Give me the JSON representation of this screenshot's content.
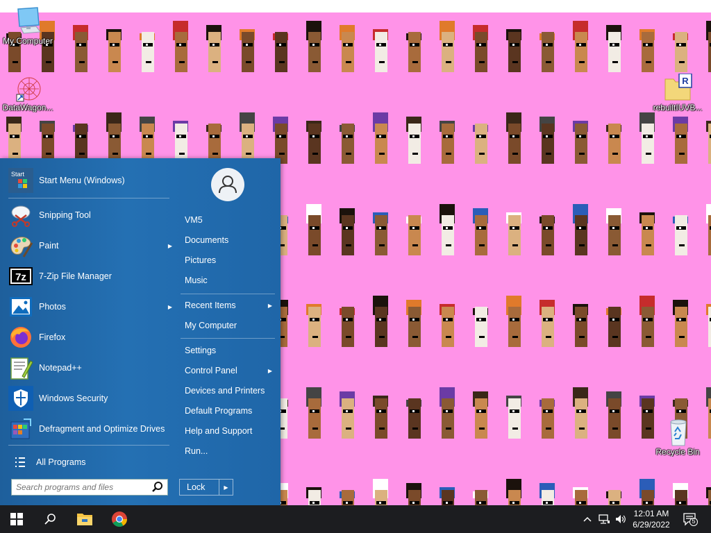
{
  "desktop": {
    "icons": [
      {
        "label": "My Computer"
      },
      {
        "label": "DataWagon..."
      },
      {
        "label": "rebuiltIUVB..."
      },
      {
        "label": "Recycle Bin"
      }
    ],
    "wallpaper_color": "#ff93e8"
  },
  "start_menu": {
    "pinned": [
      {
        "label": "Start Menu (Windows)",
        "icon": "start-menu-icon",
        "icon_text": "Start"
      },
      {
        "label": "Snipping Tool",
        "icon": "snipping-tool-icon"
      },
      {
        "label": "Paint",
        "icon": "paint-palette-icon",
        "has_submenu": true
      },
      {
        "label": "7-Zip File Manager",
        "icon": "seven-zip-icon",
        "icon_text": "7z"
      },
      {
        "label": "Photos",
        "icon": "photos-icon",
        "has_submenu": true
      },
      {
        "label": "Firefox",
        "icon": "firefox-icon"
      },
      {
        "label": "Notepad++",
        "icon": "notepadplusplus-icon"
      },
      {
        "label": "Windows Security",
        "icon": "shield-icon"
      },
      {
        "label": "Defragment and Optimize Drives",
        "icon": "defrag-icon"
      }
    ],
    "all_programs": "All Programs",
    "search_placeholder": "Search programs and files",
    "places": [
      {
        "label": "VM5"
      },
      {
        "label": "Documents"
      },
      {
        "label": "Pictures"
      },
      {
        "label": "Music"
      },
      {
        "label": "Recent Items",
        "has_submenu": true
      },
      {
        "label": "My Computer"
      },
      {
        "label": "Settings"
      },
      {
        "label": "Control Panel",
        "has_submenu": true
      },
      {
        "label": "Devices and Printers"
      },
      {
        "label": "Default Programs"
      },
      {
        "label": "Help and Support"
      },
      {
        "label": "Run..."
      }
    ],
    "power_button": "Lock",
    "accent_color": "#2470b3"
  },
  "taskbar": {
    "buttons": [
      "windows-start-icon",
      "search-icon",
      "file-explorer-icon",
      "chrome-icon"
    ],
    "tray": {
      "time": "12:01 AM",
      "date": "6/29/2022",
      "notification_count": "5"
    },
    "background": "#1c1d20"
  }
}
